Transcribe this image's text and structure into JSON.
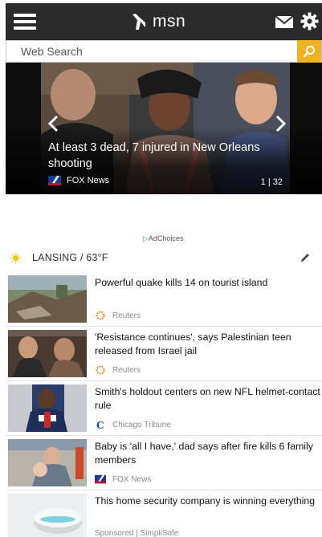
{
  "app": {
    "brand": "msn"
  },
  "search": {
    "placeholder": "Web Search"
  },
  "hero": {
    "headline": "At least 3 dead, 7 injured in New Orleans shooting",
    "source": "FOX News",
    "counter": "1 | 32"
  },
  "ad": {
    "label": "AdChoices"
  },
  "weather": {
    "text": "LANSING / 63°F"
  },
  "news": [
    {
      "title": "Powerful quake kills 14 on tourist island",
      "source": "Reuters",
      "logo": "reuters-logo"
    },
    {
      "title": "'Resistance continues', says Palestinian teen released from Israel jail",
      "source": "Reuters",
      "logo": "reuters-logo"
    },
    {
      "title": "Smith's holdout centers on new NFL helmet-contact rule",
      "source": "Chicago Tribune",
      "logo": "chicago-tribune-logo"
    },
    {
      "title": "Baby is 'all I have,' dad says after fire kills 6 family members",
      "source": "FOX News",
      "logo": "fox-news-logo"
    },
    {
      "title": "This home security company is winning everything",
      "source": "Sponsored | SimpliSafe",
      "logo": ""
    }
  ],
  "colors": {
    "topbar": "#2b2b2b",
    "search_accent": "#f0b323",
    "weather_sun": "#f5c518",
    "adchoices": "#2a8fd8"
  }
}
